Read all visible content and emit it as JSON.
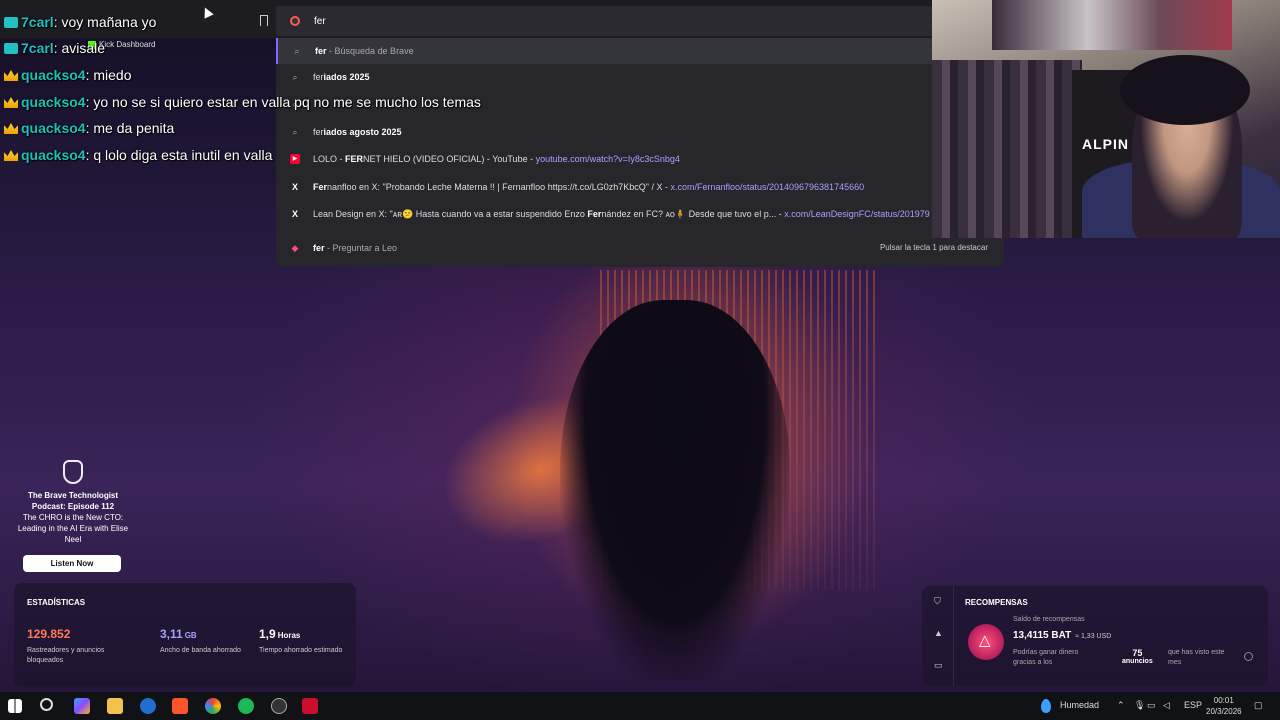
{
  "omnibox": {
    "query": "fer"
  },
  "bookmarks": {
    "kick_label": "Kick Dashboard"
  },
  "suggestions": [
    {
      "icon": "search-icon",
      "bold": "fer",
      "text": " - Búsqueda de Brave",
      "url": ""
    },
    {
      "icon": "search-icon",
      "bold": "",
      "text": "fer",
      "boldtail": "iados 2025",
      "url": ""
    },
    {
      "icon": "search-icon",
      "bold": "",
      "text": "",
      "url": ""
    },
    {
      "icon": "search-icon",
      "bold": "",
      "text": "fer",
      "boldtail": "iados agosto 2025",
      "url": ""
    },
    {
      "icon": "youtube-icon",
      "text": "LOLO - ",
      "bold": "FER",
      "rest": "NET HIELO (VIDEO OFICIAL) - YouTube - ",
      "url": "youtube.com/watch?v=Iy8c3cSnbg4"
    },
    {
      "icon": "x-icon",
      "bold": "Fer",
      "rest": "nanfloo en X: \"Probando Leche Materna !! | Fernanfloo https://t.co/LG0zh7KbcQ\" / X - ",
      "url": "x.com/Fernanfloo/status/2014096796381745660"
    },
    {
      "icon": "x-icon",
      "text": "Lean Design en X: \"ᴀʀ😕 Hasta cuando va a estar suspendido Enzo ",
      "bold": "Fer",
      "rest": "nández en FC? ᴀᴏ🧍 Desde que tuvo el p... - ",
      "url": "x.com/LeanDesignFC/status/201979"
    },
    {
      "icon": "leo-icon",
      "bold": "fer",
      "text": " - Preguntar a Leo",
      "hint": "Pulsar la tecla 1 para destacar"
    }
  ],
  "chat": [
    {
      "user": "7carl",
      "msg": ": voy mañana yo",
      "badge": "sq"
    },
    {
      "user": "7carl",
      "msg": ": avisale",
      "badge": "sq"
    },
    {
      "user": "quackso4",
      "msg": ": miedo",
      "badge": "crown"
    },
    {
      "user": "quackso4",
      "msg": ": yo no se si quiero estar en valla pq no me se mucho los temas",
      "badge": "crown"
    },
    {
      "user": "quackso4",
      "msg": ": me da penita",
      "badge": "crown"
    },
    {
      "user": "quackso4",
      "msg": ": q lolo diga esta inutil en valla",
      "badge": "crown"
    }
  ],
  "webcam": {
    "chair_text": "ALPIN"
  },
  "ad": {
    "title": "The Brave Technologist Podcast: Episode 112",
    "subtitle": "The CHRO is the New CTO: Leading in the AI Era with Elise Neel",
    "button": "Listen Now"
  },
  "stats": {
    "title": "ESTADÍSTICAS",
    "items": [
      {
        "value": "129.852",
        "unit": "",
        "label": "Rastreadores y anuncios bloqueados",
        "color": "#ff7a59"
      },
      {
        "value": "3,11",
        "unit": "GB",
        "label": "Ancho de banda ahorrado",
        "color": "#a8a2ff"
      },
      {
        "value": "1,9",
        "unit": "Horas",
        "label": "Tiempo ahorrado estimado",
        "color": "#ffffff"
      }
    ]
  },
  "rewards": {
    "title": "RECOMPENSAS",
    "subtitle": "Saldo de recompensas",
    "balance": "13,4115 BAT",
    "usd": "≈ 1,33 USD",
    "earn_text": "Podrías ganar dinero gracias a los",
    "count": "75",
    "count_label": "anuncios",
    "seen_text": "que has visto este mes"
  },
  "taskbar": {
    "weather": "Humedad",
    "lang": "ESP",
    "time": "00:01",
    "date": "20/3/2026"
  }
}
